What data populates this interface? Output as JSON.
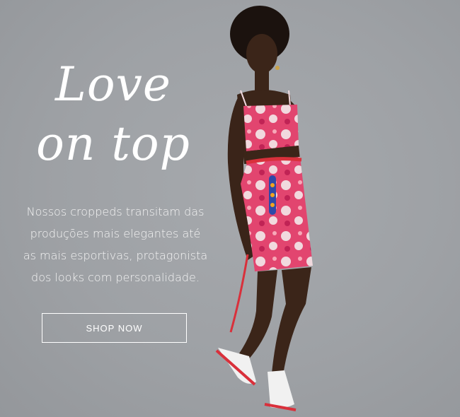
{
  "headline": {
    "line1": "Love",
    "line2": "on top"
  },
  "body_copy": {
    "lines": [
      "Nossos croppeds transitam das",
      "produções mais elegantes até",
      "as mais esportivas, protagonista",
      "dos looks com personalidade."
    ]
  },
  "cta": {
    "label": "SHOP NOW"
  },
  "colors": {
    "background": "#9ea1a5",
    "text": "#ffffff",
    "outfit_pink": "#e2456f",
    "outfit_white": "#f1d9de",
    "skin": "#3b2519",
    "hair": "#1b120e",
    "strap_red": "#d9303b"
  }
}
